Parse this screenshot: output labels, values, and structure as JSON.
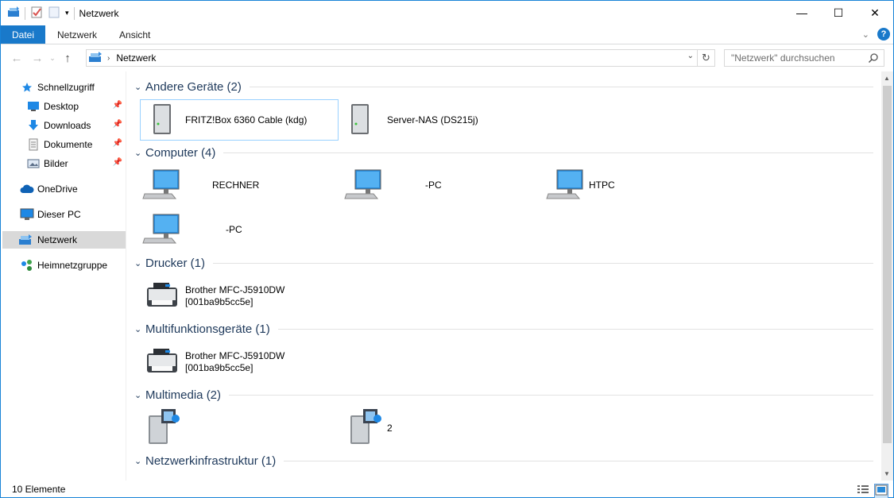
{
  "window": {
    "title": "Netzwerk",
    "controls": {
      "minimize": "—",
      "maximize": "☐",
      "close": "✕"
    }
  },
  "ribbon": {
    "tabs": [
      "Datei",
      "Netzwerk",
      "Ansicht"
    ],
    "help": "?"
  },
  "address": {
    "path": "Netzwerk",
    "search_placeholder": "\"Netzwerk\" durchsuchen"
  },
  "sidebar": {
    "items": [
      {
        "label": "Schnellzugriff",
        "icon": "star-icon"
      },
      {
        "label": "Desktop",
        "icon": "desktop-icon",
        "pinned": true
      },
      {
        "label": "Downloads",
        "icon": "download-icon",
        "pinned": true
      },
      {
        "label": "Dokumente",
        "icon": "document-icon",
        "pinned": true
      },
      {
        "label": "Bilder",
        "icon": "pictures-icon",
        "pinned": true
      },
      {
        "label": "OneDrive",
        "icon": "cloud-icon"
      },
      {
        "label": "Dieser PC",
        "icon": "pc-icon"
      },
      {
        "label": "Netzwerk",
        "icon": "network-icon",
        "selected": true
      },
      {
        "label": "Heimnetzgruppe",
        "icon": "homegroup-icon"
      }
    ]
  },
  "groups": [
    {
      "title": "Andere Geräte (2)",
      "items": [
        {
          "label": "FRITZ!Box 6360 Cable (kdg)"
        },
        {
          "label": "Server-NAS (DS215j)"
        }
      ]
    },
    {
      "title": "Computer (4)",
      "items": [
        {
          "label": "RECHNER"
        },
        {
          "label": "-PC"
        },
        {
          "label": "HTPC"
        },
        {
          "label": "-PC"
        }
      ]
    },
    {
      "title": "Drucker (1)",
      "items": [
        {
          "line1": "Brother MFC-J5910DW",
          "line2": "[001ba9b5cc5e]"
        }
      ]
    },
    {
      "title": "Multifunktionsgeräte (1)",
      "items": [
        {
          "line1": "Brother MFC-J5910DW",
          "line2": "[001ba9b5cc5e]"
        }
      ]
    },
    {
      "title": "Multimedia (2)",
      "items": [
        {
          "label": ""
        },
        {
          "label": "2"
        }
      ]
    },
    {
      "title": "Netzwerkinfrastruktur (1)",
      "items": []
    }
  ],
  "status": {
    "count": "10 Elemente"
  },
  "colors": {
    "accent": "#1979ca",
    "group_title": "#1e395b",
    "selected_nav": "#d9d9d9"
  }
}
